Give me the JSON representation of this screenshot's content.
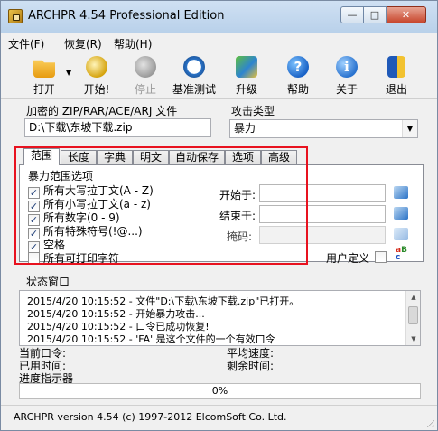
{
  "window": {
    "title": "ARCHPR 4.54 Professional Edition",
    "min_glyph": "—",
    "max_glyph": "□",
    "close_glyph": "✕"
  },
  "menu": [
    {
      "label": "文件(F)"
    },
    {
      "label": "恢复(R)"
    },
    {
      "label": "帮助(H)"
    }
  ],
  "toolbar": {
    "open": "打开",
    "start": "开始!",
    "stop": "停止",
    "benchmark": "基准测试",
    "upgrade": "升级",
    "help": "帮助",
    "about": "关于",
    "exit": "退出",
    "stop_enabled": false
  },
  "encrypted_file": {
    "label": "加密的 ZIP/RAR/ACE/ARJ 文件",
    "value": "D:\\下载\\东坡下载.zip"
  },
  "attack_type": {
    "label": "攻击类型",
    "selected": "暴力"
  },
  "tabs": [
    {
      "label": "范围",
      "active": true
    },
    {
      "label": "长度"
    },
    {
      "label": "字典"
    },
    {
      "label": "明文"
    },
    {
      "label": "自动保存"
    },
    {
      "label": "选项"
    },
    {
      "label": "高级"
    }
  ],
  "range": {
    "group_title": "暴力范围选项",
    "options": [
      {
        "label": "所有大写拉丁文(A - Z)",
        "checked": true
      },
      {
        "label": "所有小写拉丁文(a - z)",
        "checked": true
      },
      {
        "label": "所有数字(0 - 9)",
        "checked": true
      },
      {
        "label": "所有特殊符号(!@...)",
        "checked": true
      },
      {
        "label": "空格",
        "checked": true
      },
      {
        "label": "所有可打印字符",
        "checked": false
      }
    ],
    "start_from_label": "开始于:",
    "end_at_label": "结束于:",
    "mask_label": "掩码:",
    "user_defined_label": "用户定义",
    "user_defined_checked": false
  },
  "status": {
    "title": "状态窗口",
    "log": [
      "2015/4/20 10:15:52 - 文件\"D:\\下载\\东坡下载.zip\"已打开。",
      "2015/4/20 10:15:52 - 开始暴力攻击...",
      "2015/4/20 10:15:52 - 口令已成功恢复!",
      "2015/4/20 10:15:52 - 'FA' 是这个文件的一个有效口令"
    ]
  },
  "info": {
    "current_password": "当前口令:",
    "elapsed_time": "已用时间:",
    "progress_indicator": "进度指示器",
    "avg_speed": "平均速度:",
    "remaining_time": "剩余时间:"
  },
  "progress": {
    "value": 0,
    "text": "0%"
  },
  "statusbar": {
    "text": "ARCHPR version 4.54 (c) 1997-2012 ElcomSoft Co. Ltd."
  }
}
